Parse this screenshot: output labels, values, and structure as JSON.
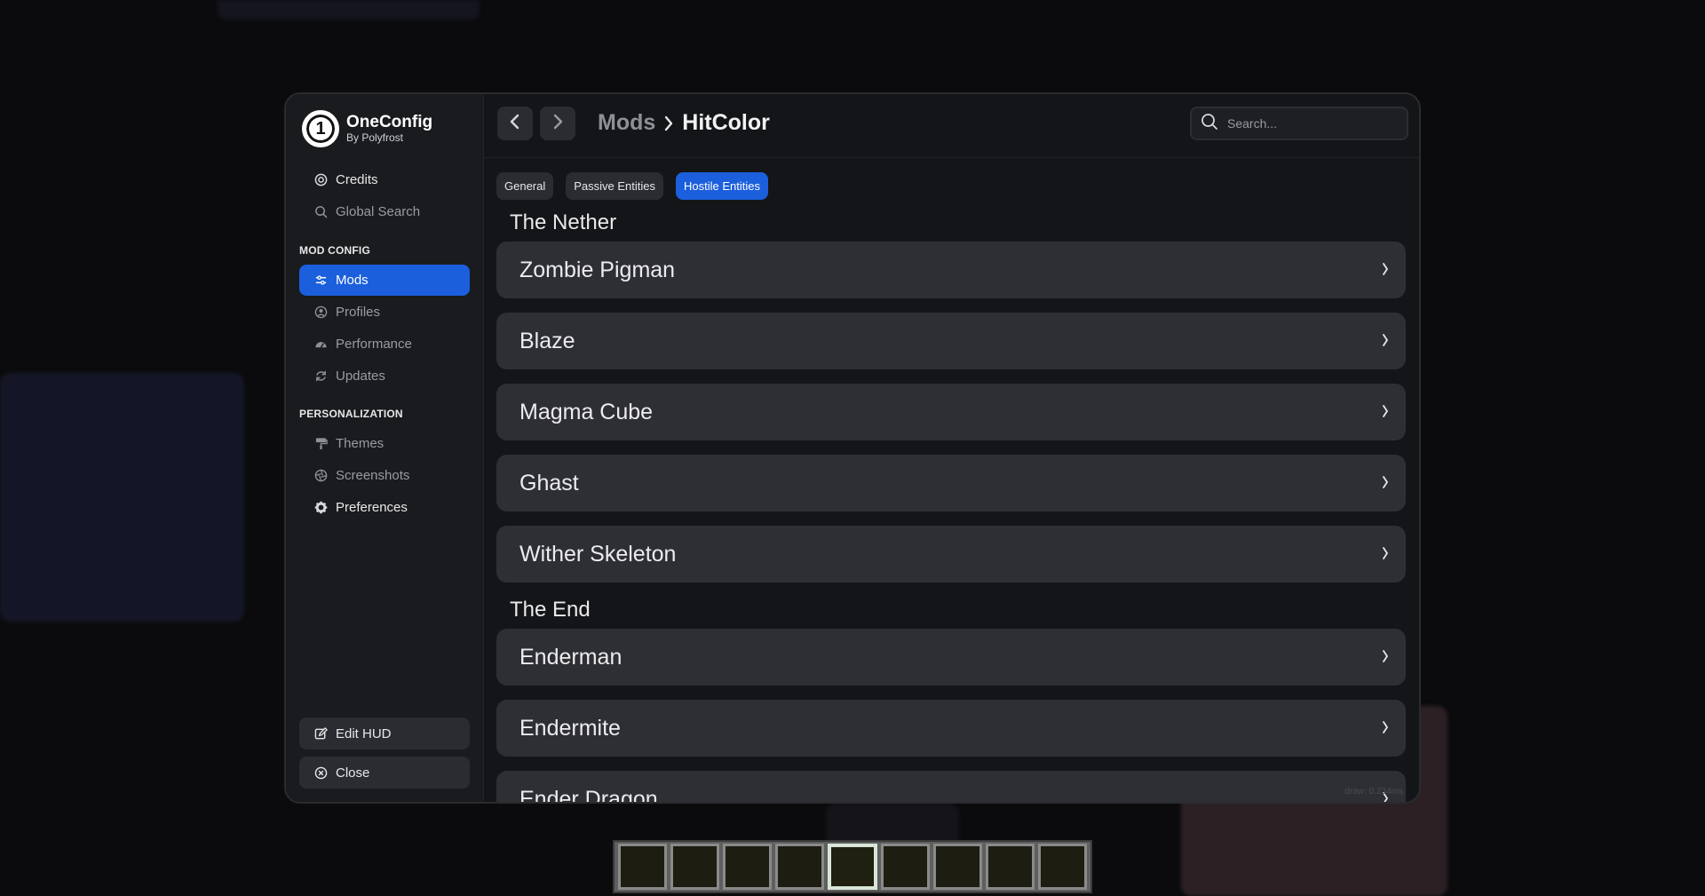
{
  "brand": {
    "title": "OneConfig",
    "subtitle": "By Polyfrost",
    "logo_glyph": "1"
  },
  "sidebar": {
    "top_items": [
      {
        "label": "Credits",
        "icon": "credits-icon"
      },
      {
        "label": "Global Search",
        "icon": "search-icon"
      }
    ],
    "sections": [
      {
        "label": "MOD CONFIG",
        "items": [
          {
            "label": "Mods",
            "icon": "sliders-icon",
            "active": true
          },
          {
            "label": "Profiles",
            "icon": "profiles-icon"
          },
          {
            "label": "Performance",
            "icon": "gauge-icon"
          },
          {
            "label": "Updates",
            "icon": "refresh-icon"
          }
        ]
      },
      {
        "label": "PERSONALIZATION",
        "items": [
          {
            "label": "Themes",
            "icon": "paint-roller-icon"
          },
          {
            "label": "Screenshots",
            "icon": "aperture-icon"
          },
          {
            "label": "Preferences",
            "icon": "gear-icon"
          }
        ]
      }
    ],
    "bottom_buttons": [
      {
        "label": "Edit HUD",
        "icon": "edit-icon"
      },
      {
        "label": "Close",
        "icon": "close-circle-icon"
      }
    ]
  },
  "header": {
    "breadcrumb": {
      "parent": "Mods",
      "current": "HitColor"
    },
    "search_placeholder": "Search..."
  },
  "tabs": [
    {
      "label": "General",
      "active": false
    },
    {
      "label": "Passive Entities",
      "active": false
    },
    {
      "label": "Hostile Entities",
      "active": true
    }
  ],
  "groups": [
    {
      "title": "The Nether",
      "items": [
        "Zombie Pigman",
        "Blaze",
        "Magma Cube",
        "Ghast",
        "Wither Skeleton"
      ]
    },
    {
      "title": "The End",
      "items": [
        "Enderman",
        "Endermite",
        "Ender Dragon"
      ]
    }
  ],
  "footer": {
    "draw_info": "draw: 0.234ms"
  },
  "hotbar": {
    "slot_count": 9,
    "selected_slot": 5
  },
  "colors": {
    "accent": "#1b5fdc",
    "window_bg": "#141518",
    "row_bg": "#2e2f34"
  }
}
